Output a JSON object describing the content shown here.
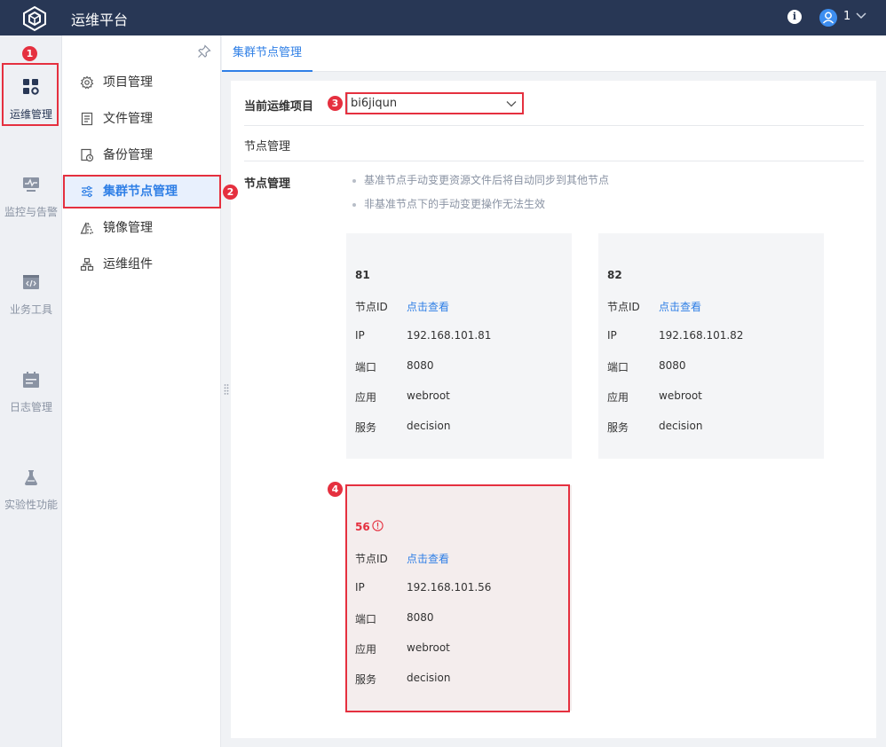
{
  "header": {
    "title": "运维平台",
    "info_icon": "info-icon",
    "user": {
      "name": "1",
      "icon": "user-avatar-icon"
    },
    "bg_color": "#283755"
  },
  "rail": {
    "items": [
      {
        "label": "运维管理",
        "icon": "grid-gear-icon",
        "active": true
      },
      {
        "label": "监控与告警",
        "icon": "monitor-icon",
        "active": false
      },
      {
        "label": "业务工具",
        "icon": "code-window-icon",
        "active": false
      },
      {
        "label": "日志管理",
        "icon": "calendar-icon",
        "active": false
      },
      {
        "label": "实验性功能",
        "icon": "flask-icon",
        "active": false
      }
    ]
  },
  "subnav": {
    "pin_icon": "pin-icon",
    "items": [
      {
        "label": "项目管理",
        "icon": "gear-icon",
        "active": false
      },
      {
        "label": "文件管理",
        "icon": "file-icon",
        "active": false
      },
      {
        "label": "备份管理",
        "icon": "backup-icon",
        "active": false
      },
      {
        "label": "集群节点管理",
        "icon": "sliders-icon",
        "active": true
      },
      {
        "label": "镜像管理",
        "icon": "mirror-icon",
        "active": false
      },
      {
        "label": "运维组件",
        "icon": "components-icon",
        "active": false
      }
    ]
  },
  "tabs": [
    {
      "label": "集群节点管理",
      "active": true
    }
  ],
  "main": {
    "project_label": "当前运维项目",
    "project_value": "bi6jiqun",
    "section_title": "节点管理",
    "node_label": "节点管理",
    "notes": [
      "基准节点手动变更资源文件后将自动同步到其他节点",
      "非基准节点下的手动变更操作无法生效"
    ],
    "field_labels": {
      "node_id": "节点ID",
      "ip": "IP",
      "port": "端口",
      "app": "应用",
      "service": "服务"
    },
    "view_link": "点击查看",
    "nodes": [
      {
        "id": "81",
        "ip": "192.168.101.81",
        "port": "8080",
        "app": "webroot",
        "service": "decision",
        "status": "normal"
      },
      {
        "id": "82",
        "ip": "192.168.101.82",
        "port": "8080",
        "app": "webroot",
        "service": "decision",
        "status": "normal"
      },
      {
        "id": "56",
        "ip": "192.168.101.56",
        "port": "8080",
        "app": "webroot",
        "service": "decision",
        "status": "error"
      }
    ]
  },
  "annotations": [
    "1",
    "2",
    "3",
    "4"
  ],
  "colors": {
    "accent": "#2f7fe6",
    "error": "#e5303f",
    "header": "#283755"
  }
}
